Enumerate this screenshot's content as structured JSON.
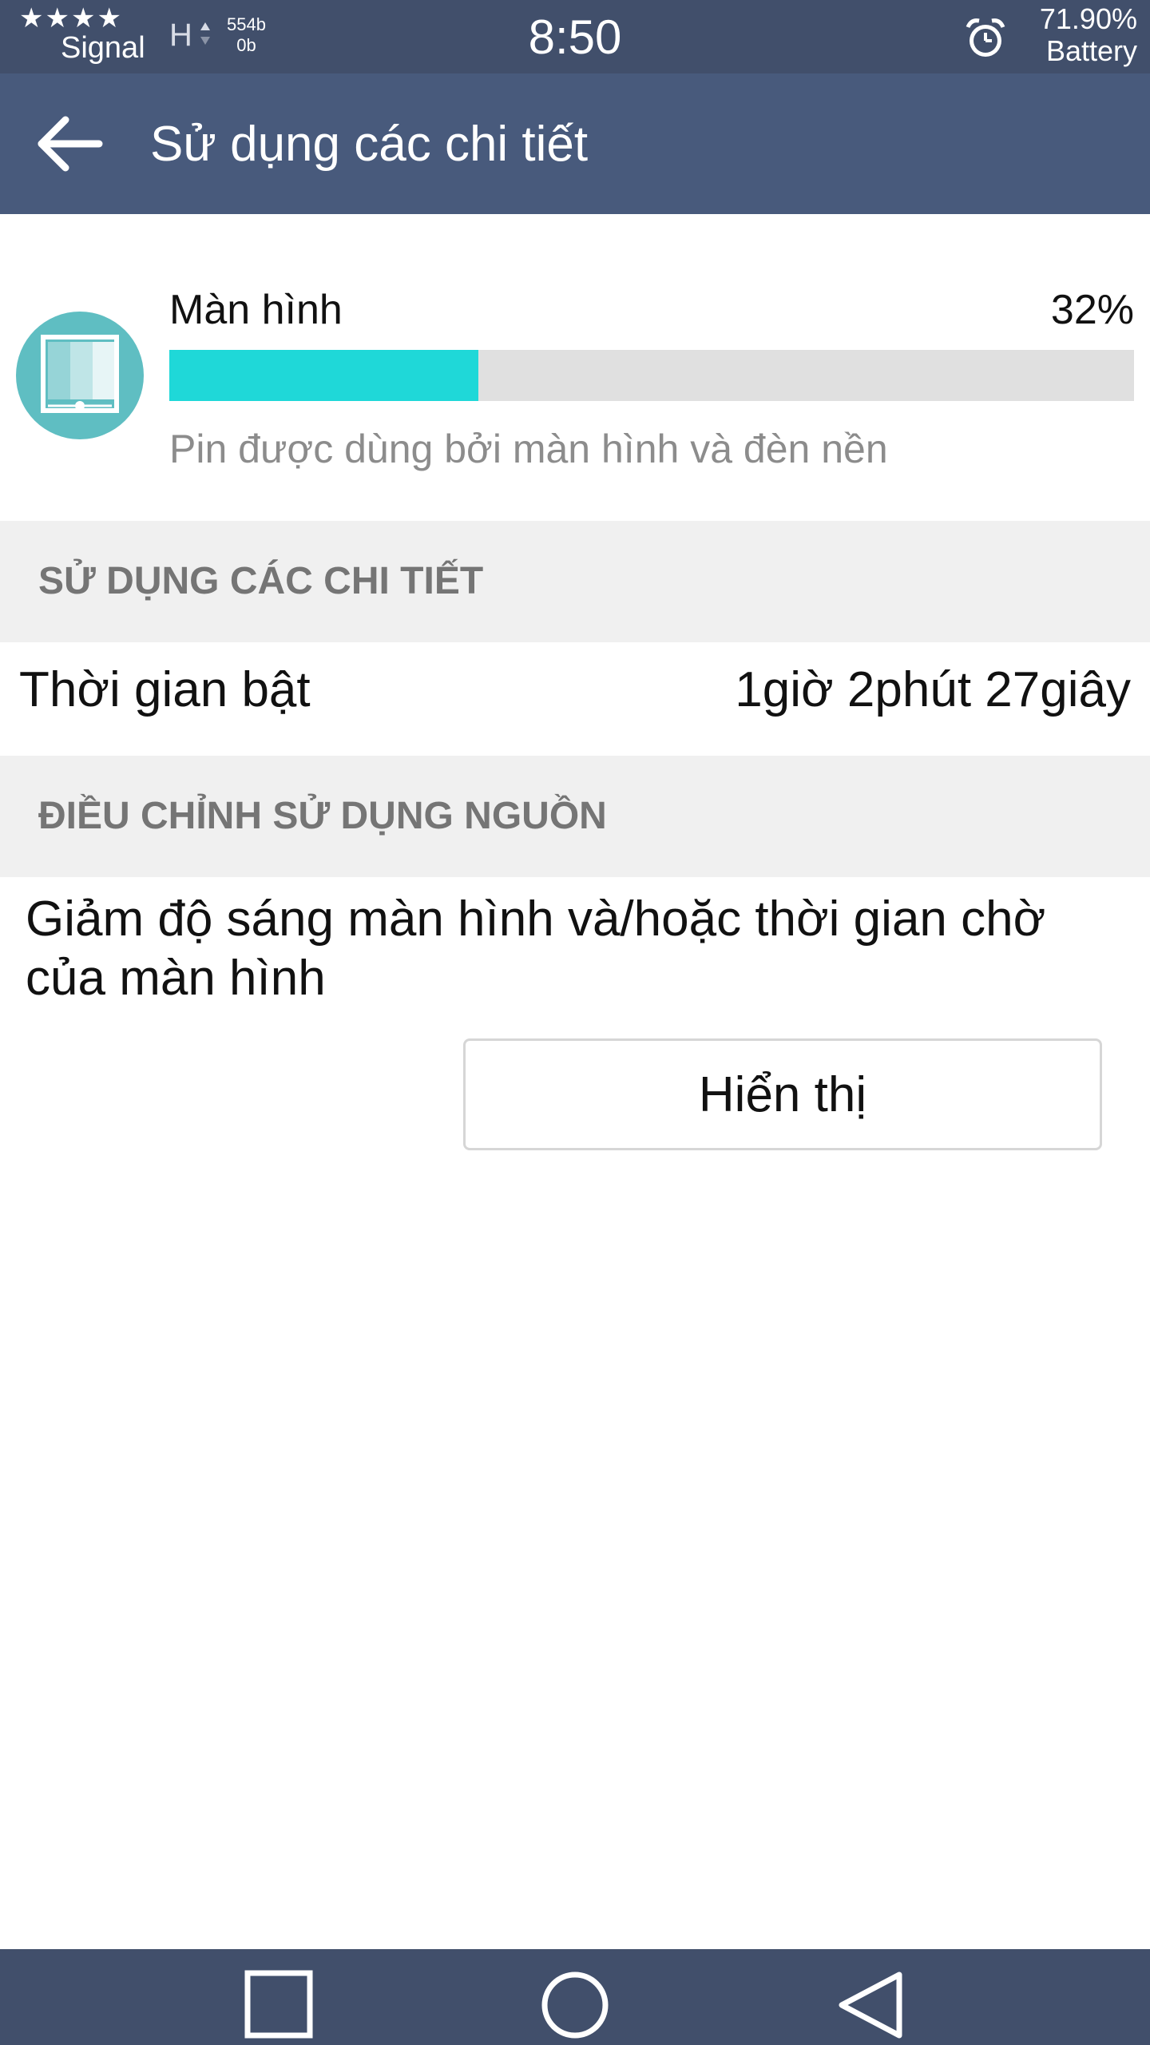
{
  "status_bar": {
    "signal_stars": "★★★★",
    "signal_label": "Signal",
    "network_type": "H",
    "rate_up": "554b",
    "rate_down": "0b",
    "time": "8:50",
    "battery_percent": "71.90%",
    "battery_label": "Battery",
    "alarm_icon": "alarm-clock-icon"
  },
  "app_bar": {
    "back_icon": "arrow-left-icon",
    "title": "Sử dụng các chi tiết"
  },
  "usage": {
    "icon": "display-icon",
    "name": "Màn hình",
    "percent_text": "32%",
    "fraction": 0.32,
    "description": "Pin được dùng bởi màn hình và đèn nền",
    "accent_color": "#1fd8d8"
  },
  "details_section": {
    "header": "SỬ DỤNG CÁC CHI TIẾT",
    "on_time_label": "Thời gian bật",
    "on_time_value": "1giờ 2phút 27giây"
  },
  "adjust_section": {
    "header": "ĐIỀU CHỈNH SỬ DỤNG NGUỒN",
    "suggestion": "Giảm độ sáng màn hình và/hoặc thời gian chờ của màn hình",
    "button_label": "Hiển thị"
  },
  "nav_bar": {
    "recents_icon": "square-icon",
    "home_icon": "circle-icon",
    "back_icon": "triangle-back-icon"
  },
  "colors": {
    "status_bar": "#414f6b",
    "app_bar": "#485a7c",
    "section_bg": "#f0f0f0"
  }
}
